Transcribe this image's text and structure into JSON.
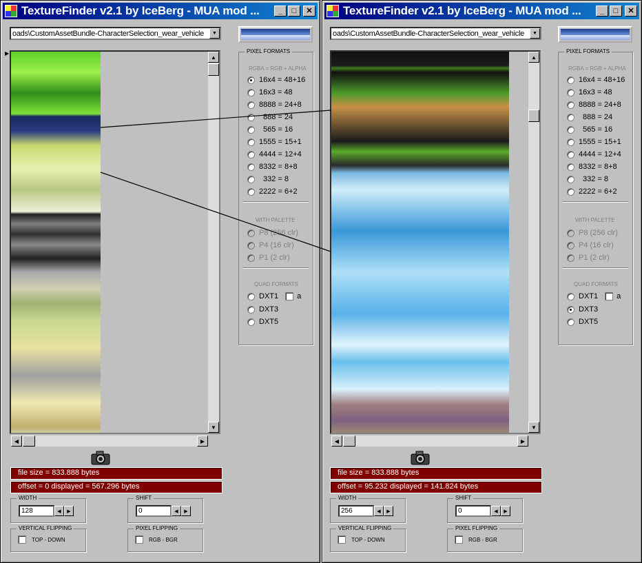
{
  "windows": [
    {
      "title": "TextureFinder v2.1 by IceBerg - MUA mod ...",
      "file_path": "oads\\CustomAssetBundle-CharacterSelection_wear_vehicle",
      "pixel_formats_label": "PIXEL FORMATS",
      "rgba_sub": "RGBA = RGB + ALPHA",
      "formats": [
        "16x4 = 48+16",
        "16x3 = 48",
        "8888 = 24+8",
        "888 = 24",
        "565 = 16",
        "1555 = 15+1",
        "4444 = 12+4",
        "8332 = 8+8",
        "332 = 8",
        "2222 = 6+2"
      ],
      "palette_sub": "WITH PALETTE",
      "palettes": [
        "P8  (256 clr)",
        "P4  (16 clr)",
        "P1  (2 clr)"
      ],
      "quad_sub": "QUAD FORMATS",
      "quads": [
        "DXT1",
        "DXT3",
        "DXT5"
      ],
      "alpha_label": "a",
      "selected": "16x4 = 48+16",
      "file_size": "file size = 833.888 bytes",
      "offset_info": "offset = 0    displayed = 567.296 bytes",
      "width_label": "WIDTH",
      "width_value": "128",
      "shift_label": "SHIFT",
      "shift_value": "0",
      "vflip_label": "VERTICAL FLIPPING",
      "vflip_option": "TOP - DOWN",
      "pflip_label": "PIXEL FLIPPING",
      "pflip_option": "RGB  -  BGR"
    },
    {
      "title": "TextureFinder v2.1 by IceBerg - MUA mod ...",
      "file_path": "oads\\CustomAssetBundle-CharacterSelection_wear_vehicle",
      "pixel_formats_label": "PIXEL FORMATS",
      "rgba_sub": "RGBA = RGB + ALPHA",
      "formats": [
        "16x4 = 48+16",
        "16x3 = 48",
        "8888 = 24+8",
        "888 = 24",
        "565 = 16",
        "1555 = 15+1",
        "4444 = 12+4",
        "8332 = 8+8",
        "332 = 8",
        "2222 = 6+2"
      ],
      "palette_sub": "WITH PALETTE",
      "palettes": [
        "P8  (256 clr)",
        "P4  (16 clr)",
        "P1  (2 clr)"
      ],
      "quad_sub": "QUAD FORMATS",
      "quads": [
        "DXT1",
        "DXT3",
        "DXT5"
      ],
      "alpha_label": "a",
      "selected": "DXT3",
      "file_size": "file size = 833.888 bytes",
      "offset_info": "offset = 95.232   displayed = 141.824 bytes",
      "width_label": "WIDTH",
      "width_value": "256",
      "shift_label": "SHIFT",
      "shift_value": "0",
      "vflip_label": "VERTICAL FLIPPING",
      "vflip_option": "TOP - DOWN",
      "pflip_label": "PIXEL FLIPPING",
      "pflip_option": "RGB  -  BGR"
    }
  ],
  "icons": {
    "app": "texturefinder-app-icon",
    "camera": "camera-icon",
    "min": "minimize-icon",
    "max": "maximize-icon",
    "close": "close-icon"
  },
  "colors": {
    "titlebar": "#000080",
    "info_bg": "#800000",
    "face": "#c0c0c0"
  }
}
